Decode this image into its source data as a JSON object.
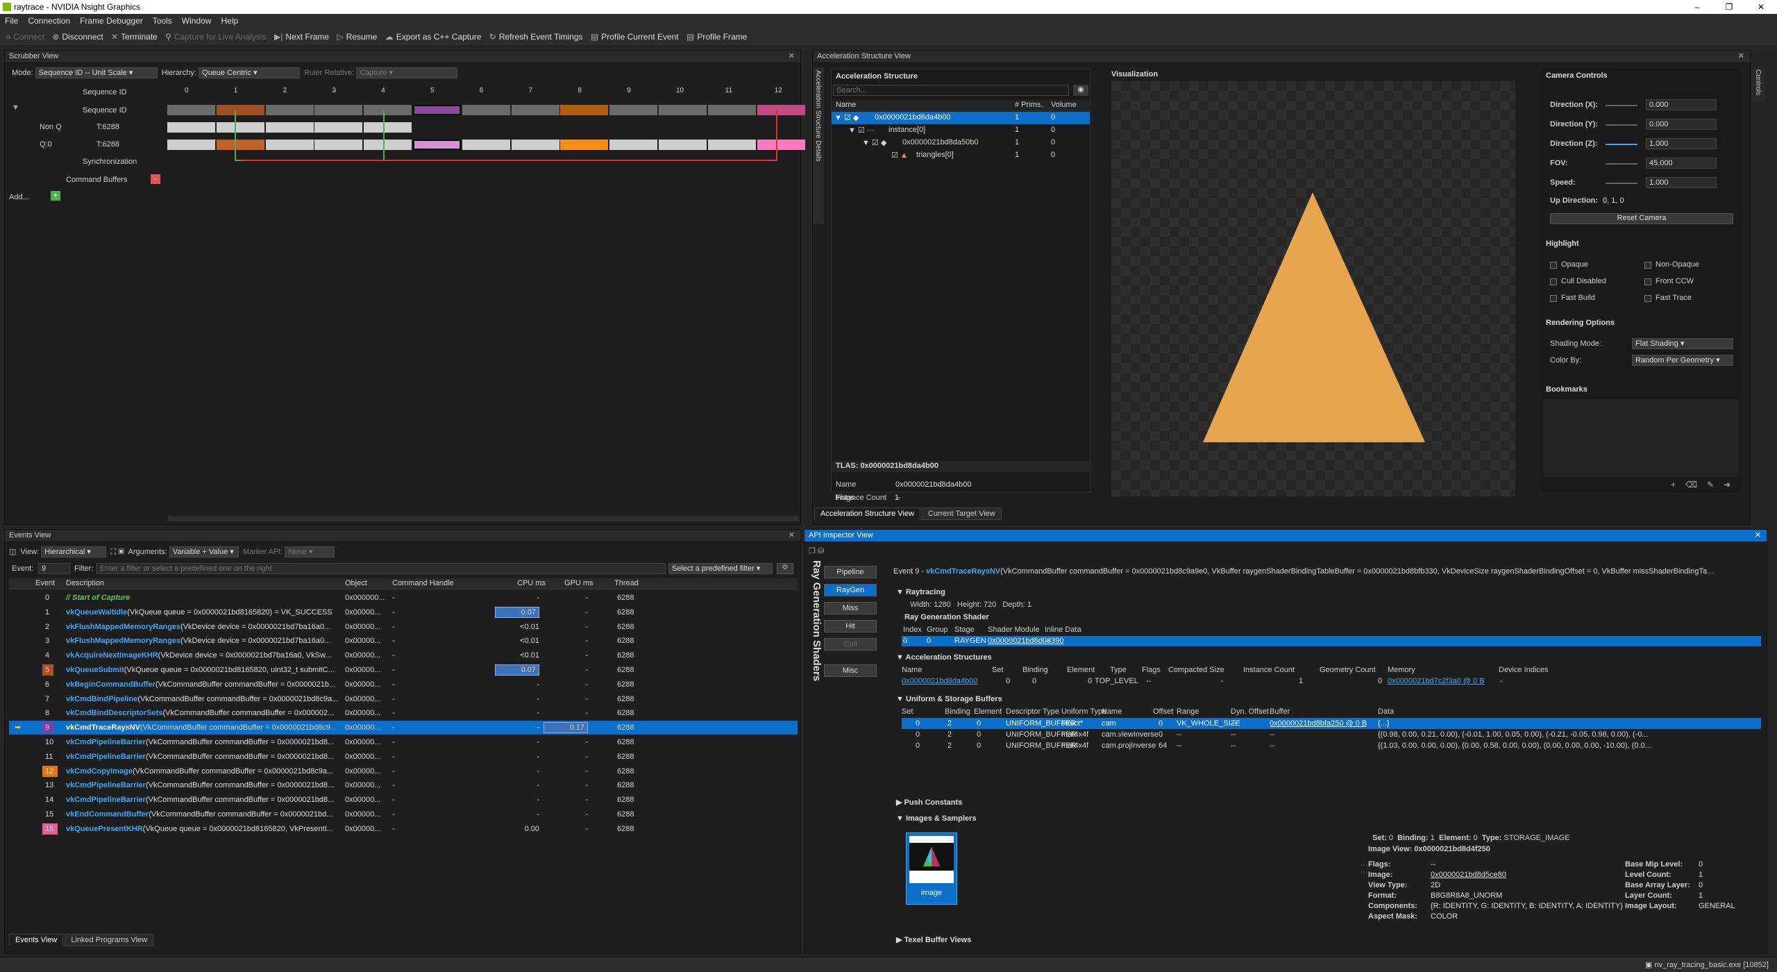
{
  "window": {
    "title": "raytrace - NVIDIA Nsight Graphics"
  },
  "menu": [
    "File",
    "Connection",
    "Frame Debugger",
    "Tools",
    "Window",
    "Help"
  ],
  "toolbar": [
    {
      "label": "Connect",
      "icon": "plug-icon",
      "enabled": false
    },
    {
      "label": "Disconnect",
      "icon": "disconnect-icon",
      "enabled": true
    },
    {
      "label": "Terminate",
      "icon": "close-icon",
      "enabled": true
    },
    {
      "label": "Capture for Live Analysis",
      "icon": "search-icon",
      "enabled": false
    },
    {
      "label": "Next Frame",
      "icon": "play-icon",
      "enabled": true
    },
    {
      "label": "Resume",
      "icon": "play-icon",
      "enabled": true
    },
    {
      "label": "Export as C++ Capture",
      "icon": "export-icon",
      "enabled": true
    },
    {
      "label": "Refresh Event Timings",
      "icon": "refresh-icon",
      "enabled": true
    },
    {
      "label": "Profile Current Event",
      "icon": "chart-icon",
      "enabled": true
    },
    {
      "label": "Profile Frame",
      "icon": "chart-icon",
      "enabled": true
    }
  ],
  "scrubber": {
    "title": "Scrubber View",
    "mode_label": "Mode:",
    "mode": "Sequence ID -- Unit Scale",
    "hierarchy_label": "Hierarchy:",
    "hierarchy": "Queue Centric",
    "ruler_label": "Ruler Relative:",
    "ruler": "Capture",
    "ticks": [
      "0",
      "1",
      "2",
      "3",
      "4",
      "5",
      "6",
      "7",
      "8",
      "9",
      "10",
      "11",
      "12"
    ],
    "rows": [
      "Sequence ID",
      "Sequence ID",
      "Non Q",
      "Q:0",
      "Synchronization",
      "Command Buffers",
      "Add..."
    ],
    "row_values": [
      "T:6288",
      "T:6288"
    ]
  },
  "events": {
    "title": "Events View",
    "view_label": "View:",
    "view": "Hierarchical",
    "args_label": "Arguments:",
    "args": "Variable + Value",
    "marker_label": "Marker API:",
    "marker": "None",
    "event_label": "Event:",
    "event_value": "9",
    "filter_label": "Filter:",
    "filter_placeholder": "Enter a filter or select a predefined one on the right",
    "predef": "Select a predefined filter",
    "columns": [
      "Event",
      "Description",
      "Object",
      "Command Handle",
      "CPU ms",
      "GPU ms",
      "Thread"
    ],
    "rows": [
      {
        "ev": "0",
        "fn": "// Start of Capture",
        "args": "",
        "obj": "0x000000...",
        "ch": "-",
        "cpu": "-",
        "gpu": "-",
        "th": "6288",
        "green": true
      },
      {
        "ev": "1",
        "fn": "vkQueueWaitIdle",
        "args": "(VkQueue queue = 0x0000021bd8165820) = VK_SUCCESS",
        "obj": "0x00000...",
        "ch": "-",
        "cpu": "0.07",
        "gpu": "-",
        "th": "6288"
      },
      {
        "ev": "2",
        "fn": "vkFlushMappedMemoryRanges",
        "args": "(VkDevice device = 0x0000021bd7ba16a0...",
        "obj": "0x00000...",
        "ch": "-",
        "cpu": "<0.01",
        "gpu": "-",
        "th": "6288"
      },
      {
        "ev": "3",
        "fn": "vkFlushMappedMemoryRanges",
        "args": "(VkDevice device = 0x0000021bd7ba16a0...",
        "obj": "0x00000...",
        "ch": "-",
        "cpu": "<0.01",
        "gpu": "-",
        "th": "6288"
      },
      {
        "ev": "4",
        "fn": "vkAcquireNextImageKHR",
        "args": "(VkDevice device = 0x0000021bd7ba16a0, VkSw...",
        "obj": "0x00000...",
        "ch": "-",
        "cpu": "<0.01",
        "gpu": "-",
        "th": "6288"
      },
      {
        "ev": "5",
        "fn": "vkQueueSubmit",
        "args": "(VkQueue queue = 0x0000021bd8165820, uint32_t submitC...",
        "obj": "0x00000...",
        "ch": "-",
        "cpu": "0.07",
        "gpu": "-",
        "th": "6288"
      },
      {
        "ev": "6",
        "fn": "vkBeginCommandBuffer",
        "args": "(VkCommandBuffer commandBuffer = 0x0000021b...",
        "obj": "0x00000...",
        "ch": "-",
        "cpu": "-",
        "gpu": "-",
        "th": "6288"
      },
      {
        "ev": "7",
        "fn": "vkCmdBindPipeline",
        "args": "(VkCommandBuffer commandBuffer = 0x0000021bd8c9a...",
        "obj": "0x00000...",
        "ch": "-",
        "cpu": "-",
        "gpu": "-",
        "th": "6288"
      },
      {
        "ev": "8",
        "fn": "vkCmdBindDescriptorSets",
        "args": "(VkCommandBuffer commandBuffer = 0x000002...",
        "obj": "0x00000...",
        "ch": "-",
        "cpu": "-",
        "gpu": "-",
        "th": "6288"
      },
      {
        "ev": "9",
        "fn": "vkCmdTraceRaysNV",
        "args": "(VkCommandBuffer commandBuffer = 0x0000021bd8c9...",
        "obj": "0x00000...",
        "ch": "-",
        "cpu": "-",
        "gpu": "0.17",
        "th": "6288",
        "selected": true
      },
      {
        "ev": "10",
        "fn": "vkCmdPipelineBarrier",
        "args": "(VkCommandBuffer commandBuffer = 0x0000021bd8...",
        "obj": "0x00000...",
        "ch": "-",
        "cpu": "-",
        "gpu": "-",
        "th": "6288"
      },
      {
        "ev": "11",
        "fn": "vkCmdPipelineBarrier",
        "args": "(VkCommandBuffer commandBuffer = 0x0000021bd8...",
        "obj": "0x00000...",
        "ch": "-",
        "cpu": "-",
        "gpu": "-",
        "th": "6288"
      },
      {
        "ev": "12",
        "fn": "vkCmdCopyImage",
        "args": "(VkCommandBuffer commandBuffer = 0x0000021bd8c9a...",
        "obj": "0x00000...",
        "ch": "-",
        "cpu": "-",
        "gpu": "-",
        "th": "6288"
      },
      {
        "ev": "13",
        "fn": "vkCmdPipelineBarrier",
        "args": "(VkCommandBuffer commandBuffer = 0x0000021bd8...",
        "obj": "0x00000...",
        "ch": "-",
        "cpu": "-",
        "gpu": "-",
        "th": "6288"
      },
      {
        "ev": "14",
        "fn": "vkCmdPipelineBarrier",
        "args": "(VkCommandBuffer commandBuffer = 0x0000021bd8...",
        "obj": "0x00000...",
        "ch": "-",
        "cpu": "-",
        "gpu": "-",
        "th": "6288"
      },
      {
        "ev": "15",
        "fn": "vkEndCommandBuffer",
        "args": "(VkCommandBuffer commandBuffer = 0x0000021bd...",
        "obj": "0x00000...",
        "ch": "-",
        "cpu": "-",
        "gpu": "-",
        "th": "6288"
      },
      {
        "ev": "16",
        "fn": "vkQueuePresentKHR",
        "args": "(VkQueue queue = 0x0000021bd8165820, VkPresentI...",
        "obj": "0x00000...",
        "ch": "-",
        "cpu": "0.00",
        "gpu": "-",
        "th": "6288"
      }
    ],
    "tabs": [
      "Events View",
      "Linked Programs View"
    ]
  },
  "accel": {
    "title": "Acceleration Structure View",
    "side_tab": "Acceleration Structure Details",
    "section": "Acceleration Structure",
    "search_placeholder": "Search...",
    "columns": [
      "Name",
      "# Prims.",
      "Volume"
    ],
    "tree": [
      {
        "name": "0x0000021bd8da4b00",
        "prims": "1",
        "vol": "0"
      },
      {
        "name": "instance[0]",
        "prims": "1",
        "vol": "0"
      },
      {
        "name": "0x0000021bd8da50b0",
        "prims": "1",
        "vol": "0"
      },
      {
        "name": "triangles[0]",
        "prims": "1",
        "vol": "0"
      }
    ],
    "tlas_title": "TLAS: 0x0000021bd8da4b00",
    "props": [
      [
        "Name",
        "0x0000021bd8da4b00"
      ],
      [
        "Flags",
        "--"
      ],
      [
        "Instance Count",
        "1"
      ]
    ],
    "viz_title": "Visualization",
    "triangle_color": "#e8a54f",
    "tabs": [
      "Acceleration Structure View",
      "Current Target View"
    ]
  },
  "camera": {
    "title": "Camera Controls",
    "side_tab": "Controls",
    "fields": [
      [
        "Direction (X):",
        "0.000"
      ],
      [
        "Direction (Y):",
        "0.000"
      ],
      [
        "Direction (Z):",
        "1.000"
      ],
      [
        "FOV:",
        "45.000"
      ],
      [
        "Speed:",
        "1.000"
      ]
    ],
    "up_label": "Up Direction:",
    "up_value": "0, 1, 0",
    "reset": "Reset Camera",
    "highlight_title": "Highlight",
    "highlight": [
      "Opaque",
      "Non-Opaque",
      "Cull Disabled",
      "Front CCW",
      "Fast Build",
      "Fast Trace"
    ],
    "render_title": "Rendering Options",
    "shading_label": "Shading Mode:",
    "shading": "Flat Shading",
    "color_label": "Color By:",
    "color": "Random Per Geometry",
    "bookmarks_title": "Bookmarks"
  },
  "api": {
    "title": "API Inspector View",
    "side_title": "Ray Generation Shaders",
    "stages": [
      "Pipeline",
      "RayGen",
      "Miss",
      "Hit",
      "Call",
      "Misc"
    ],
    "header_ev": "Event 9 -",
    "header_fn": "vkCmdTraceRaysNV",
    "header_args": "(VkCommandBuffer commandBuffer = 0x0000021bd8c9a9e0, VkBuffer raygenShaderBindingTableBuffer = 0x0000021bd8bfb330, VkDeviceSize raygenShaderBindingOffset = 0, VkBuffer missShaderBindingTa...",
    "raytracing": "Raytracing",
    "width_label": "Width:",
    "width": "1280",
    "height_label": "Height:",
    "height": "720",
    "depth_label": "Depth:",
    "depth": "1",
    "rgs_title": "Ray Generation Shader",
    "rgs_cols": [
      "Index",
      "Group",
      "Stage",
      "Shader Module",
      "Inline Data"
    ],
    "rgs_row": [
      "0",
      "0",
      "RAYGEN",
      "0x0000021bd8d08390",
      "--"
    ],
    "as_title": "Acceleration Structures",
    "as_cols": [
      "Name",
      "Set",
      "Binding",
      "Element",
      "Type",
      "Flags",
      "Compacted Size",
      "Instance Count",
      "Geometry Count",
      "Memory",
      "Device Indices"
    ],
    "as_row": [
      "0x0000021bd8da4b00",
      "0",
      "0",
      "0",
      "TOP_LEVEL",
      "--",
      "-",
      "1",
      "0",
      "0x0000021bd7c2f3a0 @ 0 B",
      "-"
    ],
    "usb_title": "Uniform & Storage Buffers",
    "usb_cols": [
      "Set",
      "Binding",
      "Element",
      "Descriptor Type",
      "Uniform Type",
      "Name",
      "Offset",
      "Range",
      "Dyn. Offset",
      "Buffer",
      "Data"
    ],
    "usb_rows": [
      [
        "0",
        "2",
        "0",
        "UNIFORM_BUFFER",
        "struct*",
        "cam",
        "0",
        "VK_WHOLE_SIZE",
        "--",
        "0x0000021bd8bfa250 @ 0 B",
        "{...}"
      ],
      [
        "0",
        "2",
        "0",
        "UNIFORM_BUFFER",
        "mat4x4f",
        "cam.viewInverse",
        "0",
        "--",
        "--",
        "--",
        "{(0.98, 0.00, 0.21, 0.00), (-0.01, 1.00, 0.05, 0.00), (-0.21, -0.05, 0.98, 0.00), (-0..."
      ],
      [
        "0",
        "2",
        "0",
        "UNIFORM_BUFFER",
        "mat4x4f",
        "cam.projInverse",
        "64",
        "--",
        "--",
        "--",
        "{(1.03, 0.00, 0.00, 0.00), (0.00, 0.58, 0.00, 0.00), (0.00, 0.00, 0.00, -10.00), (0.0..."
      ]
    ],
    "push": "Push Constants",
    "images_title": "Images & Samplers",
    "thumb_label": "image",
    "img_top": [
      [
        "Set:",
        "0"
      ],
      [
        "Binding:",
        "1"
      ],
      [
        "Element:",
        "0"
      ],
      [
        "Type:",
        "STORAGE_IMAGE"
      ]
    ],
    "img_view": "Image View: 0x0000021bd8d4f250",
    "img_left": [
      [
        "Flags:",
        "--"
      ],
      [
        "Image:",
        "0x0000021bd8d5ce80"
      ],
      [
        "View Type:",
        "2D"
      ],
      [
        "Format:",
        "B8G8R8A8_UNORM"
      ],
      [
        "Components:",
        "{R: IDENTITY, G: IDENTITY, B: IDENTITY, A: IDENTITY}"
      ],
      [
        "Aspect Mask:",
        "COLOR"
      ]
    ],
    "img_right": [
      [
        "Base Mip Level:",
        "0"
      ],
      [
        "Level Count:",
        "1"
      ],
      [
        "Base Array Layer:",
        "0"
      ],
      [
        "Layer Count:",
        "1"
      ],
      [
        "Image Layout:",
        "GENERAL"
      ]
    ],
    "texel": "Texel Buffer Views"
  },
  "status": {
    "process": "nv_ray_tracing_basic.exe [10852]"
  }
}
